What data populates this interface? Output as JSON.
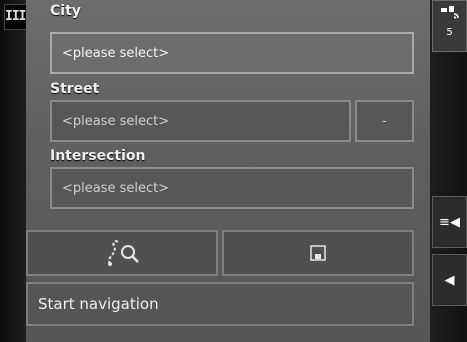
{
  "app": {
    "logo_text": "IIIII"
  },
  "form": {
    "city": {
      "label": "City",
      "value": "<please select>"
    },
    "street": {
      "label": "Street",
      "value": "<please select>",
      "house_number": "-"
    },
    "intersection": {
      "label": "Intersection",
      "value": "<please select>"
    }
  },
  "actions": {
    "start_navigation_label": "Start navigation"
  },
  "side": {
    "gps_count": "5",
    "menu_glyph": "≡◀",
    "back_glyph": "◀"
  }
}
